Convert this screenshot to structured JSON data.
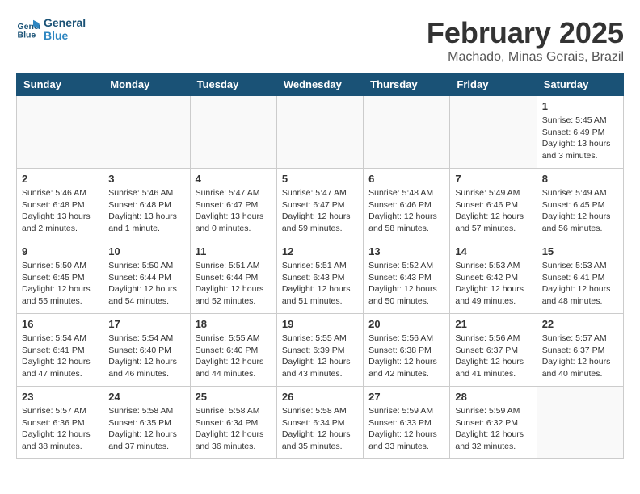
{
  "header": {
    "logo_line1": "General",
    "logo_line2": "Blue",
    "title": "February 2025",
    "subtitle": "Machado, Minas Gerais, Brazil"
  },
  "weekdays": [
    "Sunday",
    "Monday",
    "Tuesday",
    "Wednesday",
    "Thursday",
    "Friday",
    "Saturday"
  ],
  "weeks": [
    [
      {
        "day": "",
        "info": ""
      },
      {
        "day": "",
        "info": ""
      },
      {
        "day": "",
        "info": ""
      },
      {
        "day": "",
        "info": ""
      },
      {
        "day": "",
        "info": ""
      },
      {
        "day": "",
        "info": ""
      },
      {
        "day": "1",
        "info": "Sunrise: 5:45 AM\nSunset: 6:49 PM\nDaylight: 13 hours\nand 3 minutes."
      }
    ],
    [
      {
        "day": "2",
        "info": "Sunrise: 5:46 AM\nSunset: 6:48 PM\nDaylight: 13 hours\nand 2 minutes."
      },
      {
        "day": "3",
        "info": "Sunrise: 5:46 AM\nSunset: 6:48 PM\nDaylight: 13 hours\nand 1 minute."
      },
      {
        "day": "4",
        "info": "Sunrise: 5:47 AM\nSunset: 6:47 PM\nDaylight: 13 hours\nand 0 minutes."
      },
      {
        "day": "5",
        "info": "Sunrise: 5:47 AM\nSunset: 6:47 PM\nDaylight: 12 hours\nand 59 minutes."
      },
      {
        "day": "6",
        "info": "Sunrise: 5:48 AM\nSunset: 6:46 PM\nDaylight: 12 hours\nand 58 minutes."
      },
      {
        "day": "7",
        "info": "Sunrise: 5:49 AM\nSunset: 6:46 PM\nDaylight: 12 hours\nand 57 minutes."
      },
      {
        "day": "8",
        "info": "Sunrise: 5:49 AM\nSunset: 6:45 PM\nDaylight: 12 hours\nand 56 minutes."
      }
    ],
    [
      {
        "day": "9",
        "info": "Sunrise: 5:50 AM\nSunset: 6:45 PM\nDaylight: 12 hours\nand 55 minutes."
      },
      {
        "day": "10",
        "info": "Sunrise: 5:50 AM\nSunset: 6:44 PM\nDaylight: 12 hours\nand 54 minutes."
      },
      {
        "day": "11",
        "info": "Sunrise: 5:51 AM\nSunset: 6:44 PM\nDaylight: 12 hours\nand 52 minutes."
      },
      {
        "day": "12",
        "info": "Sunrise: 5:51 AM\nSunset: 6:43 PM\nDaylight: 12 hours\nand 51 minutes."
      },
      {
        "day": "13",
        "info": "Sunrise: 5:52 AM\nSunset: 6:43 PM\nDaylight: 12 hours\nand 50 minutes."
      },
      {
        "day": "14",
        "info": "Sunrise: 5:53 AM\nSunset: 6:42 PM\nDaylight: 12 hours\nand 49 minutes."
      },
      {
        "day": "15",
        "info": "Sunrise: 5:53 AM\nSunset: 6:41 PM\nDaylight: 12 hours\nand 48 minutes."
      }
    ],
    [
      {
        "day": "16",
        "info": "Sunrise: 5:54 AM\nSunset: 6:41 PM\nDaylight: 12 hours\nand 47 minutes."
      },
      {
        "day": "17",
        "info": "Sunrise: 5:54 AM\nSunset: 6:40 PM\nDaylight: 12 hours\nand 46 minutes."
      },
      {
        "day": "18",
        "info": "Sunrise: 5:55 AM\nSunset: 6:40 PM\nDaylight: 12 hours\nand 44 minutes."
      },
      {
        "day": "19",
        "info": "Sunrise: 5:55 AM\nSunset: 6:39 PM\nDaylight: 12 hours\nand 43 minutes."
      },
      {
        "day": "20",
        "info": "Sunrise: 5:56 AM\nSunset: 6:38 PM\nDaylight: 12 hours\nand 42 minutes."
      },
      {
        "day": "21",
        "info": "Sunrise: 5:56 AM\nSunset: 6:37 PM\nDaylight: 12 hours\nand 41 minutes."
      },
      {
        "day": "22",
        "info": "Sunrise: 5:57 AM\nSunset: 6:37 PM\nDaylight: 12 hours\nand 40 minutes."
      }
    ],
    [
      {
        "day": "23",
        "info": "Sunrise: 5:57 AM\nSunset: 6:36 PM\nDaylight: 12 hours\nand 38 minutes."
      },
      {
        "day": "24",
        "info": "Sunrise: 5:58 AM\nSunset: 6:35 PM\nDaylight: 12 hours\nand 37 minutes."
      },
      {
        "day": "25",
        "info": "Sunrise: 5:58 AM\nSunset: 6:34 PM\nDaylight: 12 hours\nand 36 minutes."
      },
      {
        "day": "26",
        "info": "Sunrise: 5:58 AM\nSunset: 6:34 PM\nDaylight: 12 hours\nand 35 minutes."
      },
      {
        "day": "27",
        "info": "Sunrise: 5:59 AM\nSunset: 6:33 PM\nDaylight: 12 hours\nand 33 minutes."
      },
      {
        "day": "28",
        "info": "Sunrise: 5:59 AM\nSunset: 6:32 PM\nDaylight: 12 hours\nand 32 minutes."
      },
      {
        "day": "",
        "info": ""
      }
    ]
  ]
}
